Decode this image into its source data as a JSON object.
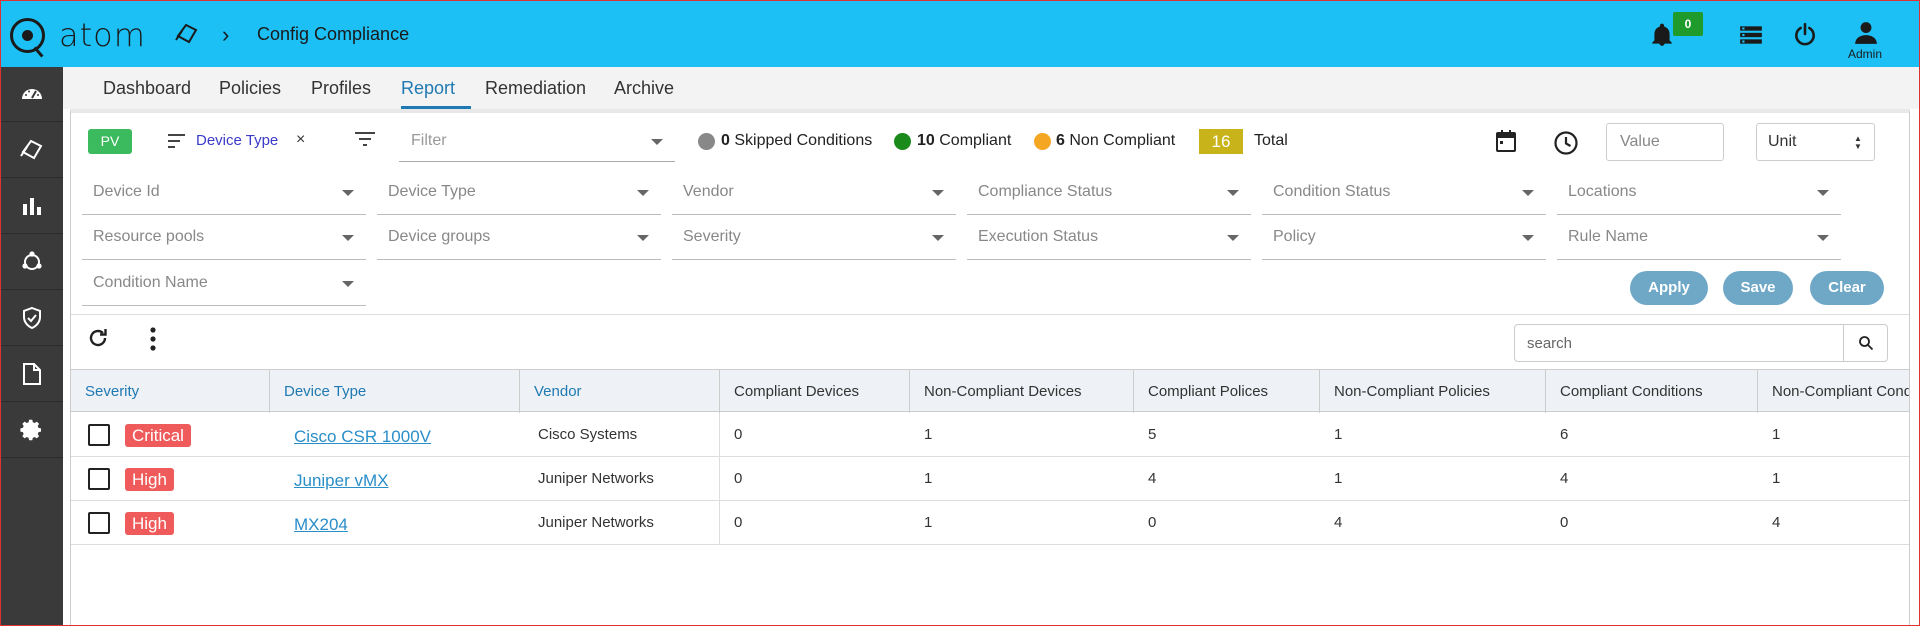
{
  "app": {
    "logo_text": "atom",
    "user": "Admin"
  },
  "breadcrumb": {
    "separator": "›",
    "title": "Config Compliance"
  },
  "notifications": {
    "count": "0"
  },
  "tabs": [
    "Dashboard",
    "Policies",
    "Profiles",
    "Report",
    "Remediation",
    "Archive"
  ],
  "active_tab": "Report",
  "filter_bar": {
    "pv_label": "PV",
    "chip_label": "Device Type",
    "chip_close": "×",
    "filter_placeholder": "Filter",
    "stats": {
      "skipped_count": "0",
      "skipped_label": "Skipped Conditions",
      "compliant_count": "10",
      "compliant_label": "Compliant",
      "noncompliant_count": "6",
      "noncompliant_label": "Non Compliant",
      "total_count": "16",
      "total_label": "Total"
    },
    "value_placeholder": "Value",
    "unit_label": "Unit"
  },
  "filters": {
    "row1": [
      "Device Id",
      "Device Type",
      "Vendor",
      "Compliance Status",
      "Condition Status",
      "Locations"
    ],
    "row2": [
      "Resource pools",
      "Device groups",
      "Severity",
      "Execution Status",
      "Policy",
      "Rule Name"
    ],
    "row3": [
      "Condition Name"
    ]
  },
  "actions": {
    "apply": "Apply",
    "save": "Save",
    "clear": "Clear"
  },
  "search": {
    "placeholder": "search"
  },
  "table": {
    "headers": [
      "Severity",
      "Device Type",
      "Vendor",
      "Compliant Devices",
      "Non-Compliant Devices",
      "Compliant Polices",
      "Non-Compliant Policies",
      "Compliant Conditions",
      "Non-Compliant Conditions"
    ],
    "rows": [
      {
        "severity": "Critical",
        "device_type": "Cisco CSR 1000V",
        "vendor": "Cisco Systems",
        "compliant_devices": "0",
        "noncompliant_devices": "1",
        "compliant_policies": "5",
        "noncompliant_policies": "1",
        "compliant_conditions": "6",
        "noncompliant_conditions": "1"
      },
      {
        "severity": "High",
        "device_type": "Juniper vMX",
        "vendor": "Juniper Networks",
        "compliant_devices": "0",
        "noncompliant_devices": "1",
        "compliant_policies": "4",
        "noncompliant_policies": "1",
        "compliant_conditions": "4",
        "noncompliant_conditions": "1"
      },
      {
        "severity": "High",
        "device_type": "MX204",
        "vendor": "Juniper Networks",
        "compliant_devices": "0",
        "noncompliant_devices": "1",
        "compliant_policies": "0",
        "noncompliant_policies": "4",
        "compliant_conditions": "0",
        "noncompliant_conditions": "4"
      }
    ]
  },
  "colors": {
    "header_bg": "#1cc0f5",
    "sidebar_bg": "#3a3a3a",
    "accent": "#1f7ab3",
    "skipped": "#888888",
    "compliant": "#1a8a1a",
    "noncompliant": "#f5a623",
    "total_badge": "#c9b31a",
    "severity": "#ef5a5a",
    "pv": "#3cba5e",
    "button": "#6fa8c7"
  },
  "sidebar_icons": [
    "dashboard-gauge-icon",
    "compliance-icon",
    "bar-chart-icon",
    "network-nodes-icon",
    "shield-check-icon",
    "document-icon",
    "settings-gear-icon"
  ]
}
